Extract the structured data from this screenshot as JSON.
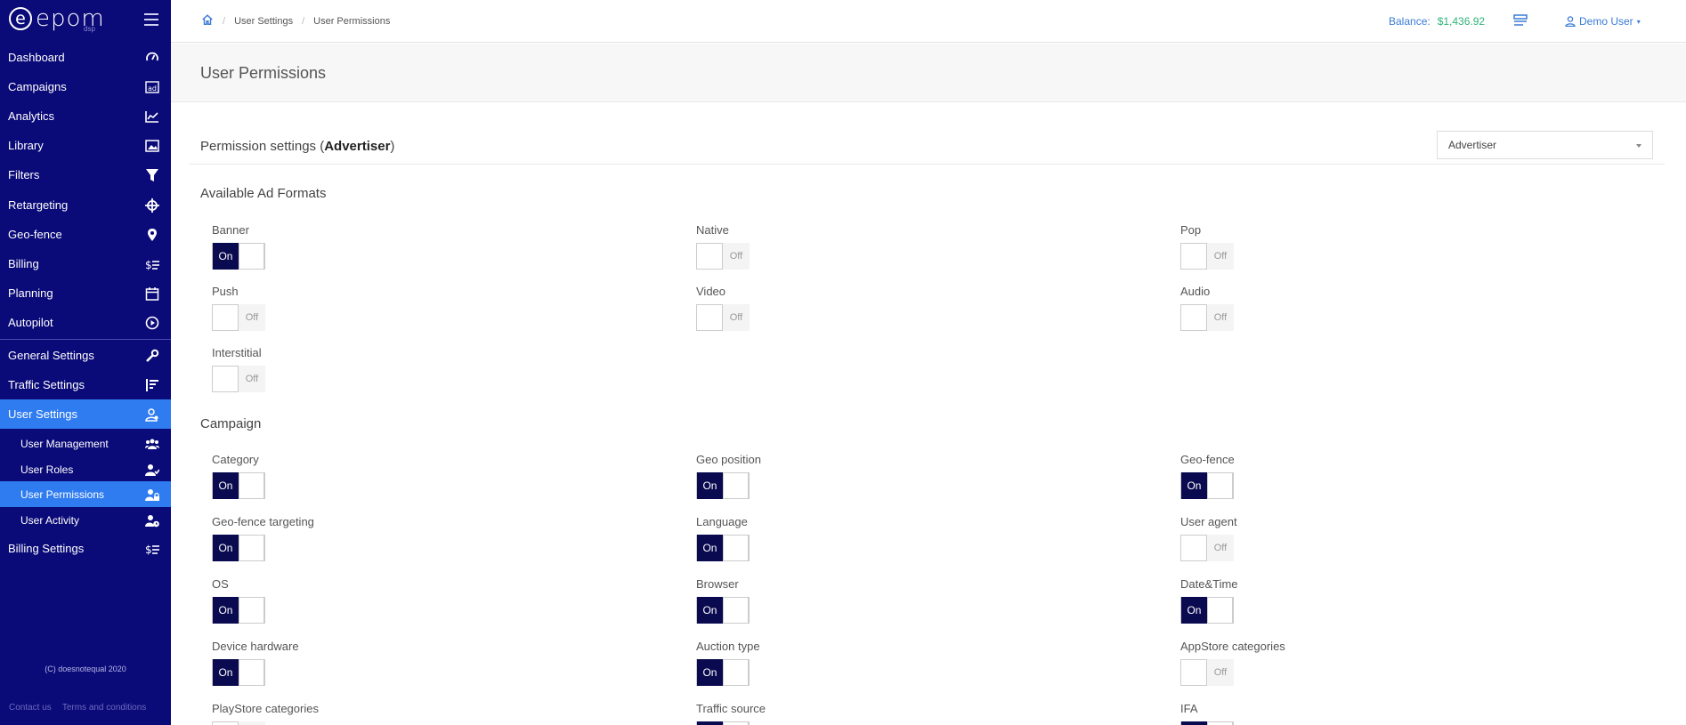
{
  "brand": {
    "name": "epom",
    "sub": "dsp"
  },
  "sidebar": {
    "items": [
      {
        "label": "Dashboard",
        "icon": "gauge-icon"
      },
      {
        "label": "Campaigns",
        "icon": "ad-icon"
      },
      {
        "label": "Analytics",
        "icon": "chart-icon"
      },
      {
        "label": "Library",
        "icon": "image-icon"
      },
      {
        "label": "Filters",
        "icon": "filter-icon"
      },
      {
        "label": "Retargeting",
        "icon": "crosshair-icon"
      },
      {
        "label": "Geo-fence",
        "icon": "map-pin-icon"
      },
      {
        "label": "Billing",
        "icon": "dollar-list-icon"
      },
      {
        "label": "Planning",
        "icon": "calendar-icon"
      },
      {
        "label": "Autopilot",
        "icon": "play-circle-icon"
      },
      {
        "label": "General Settings",
        "icon": "wrench-icon"
      },
      {
        "label": "Traffic Settings",
        "icon": "traffic-icon"
      },
      {
        "label": "User Settings",
        "icon": "user-cog-icon"
      },
      {
        "label": "User Management",
        "icon": "users-icon"
      },
      {
        "label": "User Roles",
        "icon": "user-role-icon"
      },
      {
        "label": "User Permissions",
        "icon": "user-lock-icon"
      },
      {
        "label": "User Activity",
        "icon": "user-clock-icon"
      },
      {
        "label": "Billing Settings",
        "icon": "dollar-list-icon"
      }
    ],
    "copyright": "(C) doesnotequal 2020",
    "footer": {
      "contact": "Contact us",
      "terms": "Terms and conditions"
    }
  },
  "topbar": {
    "breadcrumb": [
      "User Settings",
      "User Permissions"
    ],
    "balance_label": "Balance:",
    "balance_amount": "$1,436.92",
    "user": "Demo User"
  },
  "page": {
    "title": "User Permissions",
    "settings_prefix": "Permission settings (",
    "settings_role": "Advertiser",
    "settings_suffix": ")",
    "role_select": "Advertiser"
  },
  "toggle_text": {
    "on": "On",
    "off": "Off"
  },
  "ad_formats": {
    "title": "Available Ad Formats",
    "items": [
      {
        "label": "Banner",
        "state": "on"
      },
      {
        "label": "Native",
        "state": "off"
      },
      {
        "label": "Pop",
        "state": "off"
      },
      {
        "label": "Push",
        "state": "off"
      },
      {
        "label": "Video",
        "state": "off"
      },
      {
        "label": "Audio",
        "state": "off"
      },
      {
        "label": "Interstitial",
        "state": "off"
      }
    ]
  },
  "campaign": {
    "title": "Campaign",
    "items": [
      {
        "label": "Category",
        "state": "on"
      },
      {
        "label": "Geo position",
        "state": "on"
      },
      {
        "label": "Geo-fence",
        "state": "on"
      },
      {
        "label": "Geo-fence targeting",
        "state": "on"
      },
      {
        "label": "Language",
        "state": "on"
      },
      {
        "label": "User agent",
        "state": "off"
      },
      {
        "label": "OS",
        "state": "on"
      },
      {
        "label": "Browser",
        "state": "on"
      },
      {
        "label": "Date&Time",
        "state": "on"
      },
      {
        "label": "Device hardware",
        "state": "on"
      },
      {
        "label": "Auction type",
        "state": "on"
      },
      {
        "label": "AppStore categories",
        "state": "off"
      },
      {
        "label": "PlayStore categories",
        "state": "off"
      },
      {
        "label": "Traffic source",
        "state": "on"
      },
      {
        "label": "IFA",
        "state": "on"
      }
    ]
  }
}
